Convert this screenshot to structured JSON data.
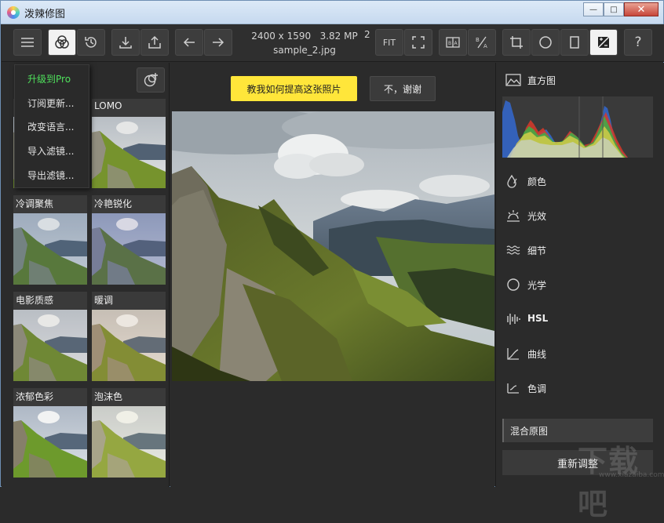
{
  "window": {
    "title": "泼辣修图"
  },
  "toolbar": {
    "image_size": "2400 x 1590",
    "megapixels": "3.82 MP",
    "extra": "2",
    "filename": "sample_2.jpg",
    "fit_label": "FIT",
    "help_label": "?",
    "ba_label": "B|A"
  },
  "menu": {
    "items": [
      "升级到Pro",
      "订阅更新...",
      "改变语言...",
      "导入滤镜...",
      "导出滤镜..."
    ]
  },
  "filters": {
    "items": [
      {
        "label": "",
        "tone": "normal"
      },
      {
        "label": "LOMO",
        "tone": "lomo"
      },
      {
        "label": "冷调聚焦",
        "tone": "cool"
      },
      {
        "label": "冷艳锐化",
        "tone": "coolsharp"
      },
      {
        "label": "电影质感",
        "tone": "film"
      },
      {
        "label": "暖调",
        "tone": "warm"
      },
      {
        "label": "浓郁色彩",
        "tone": "rich"
      },
      {
        "label": "泡沫色",
        "tone": "foam"
      }
    ]
  },
  "prompt": {
    "primary": "教我如何提高这张照片",
    "secondary": "不，谢谢"
  },
  "panel": {
    "histogram_title": "直方图",
    "adjustments": [
      {
        "label": "颜色",
        "icon": "drops-icon"
      },
      {
        "label": "光效",
        "icon": "sun-icon"
      },
      {
        "label": "细节",
        "icon": "waves-icon"
      },
      {
        "label": "光学",
        "icon": "circle-icon"
      },
      {
        "label": "HSL",
        "icon": "bars-icon"
      },
      {
        "label": "曲线",
        "icon": "curve-icon"
      },
      {
        "label": "色调",
        "icon": "tone-icon"
      }
    ],
    "blend_label": "混合原图",
    "reset_label": "重新调整"
  },
  "watermark": {
    "text": "下载吧",
    "sub": "www.xiazaiba.com"
  }
}
